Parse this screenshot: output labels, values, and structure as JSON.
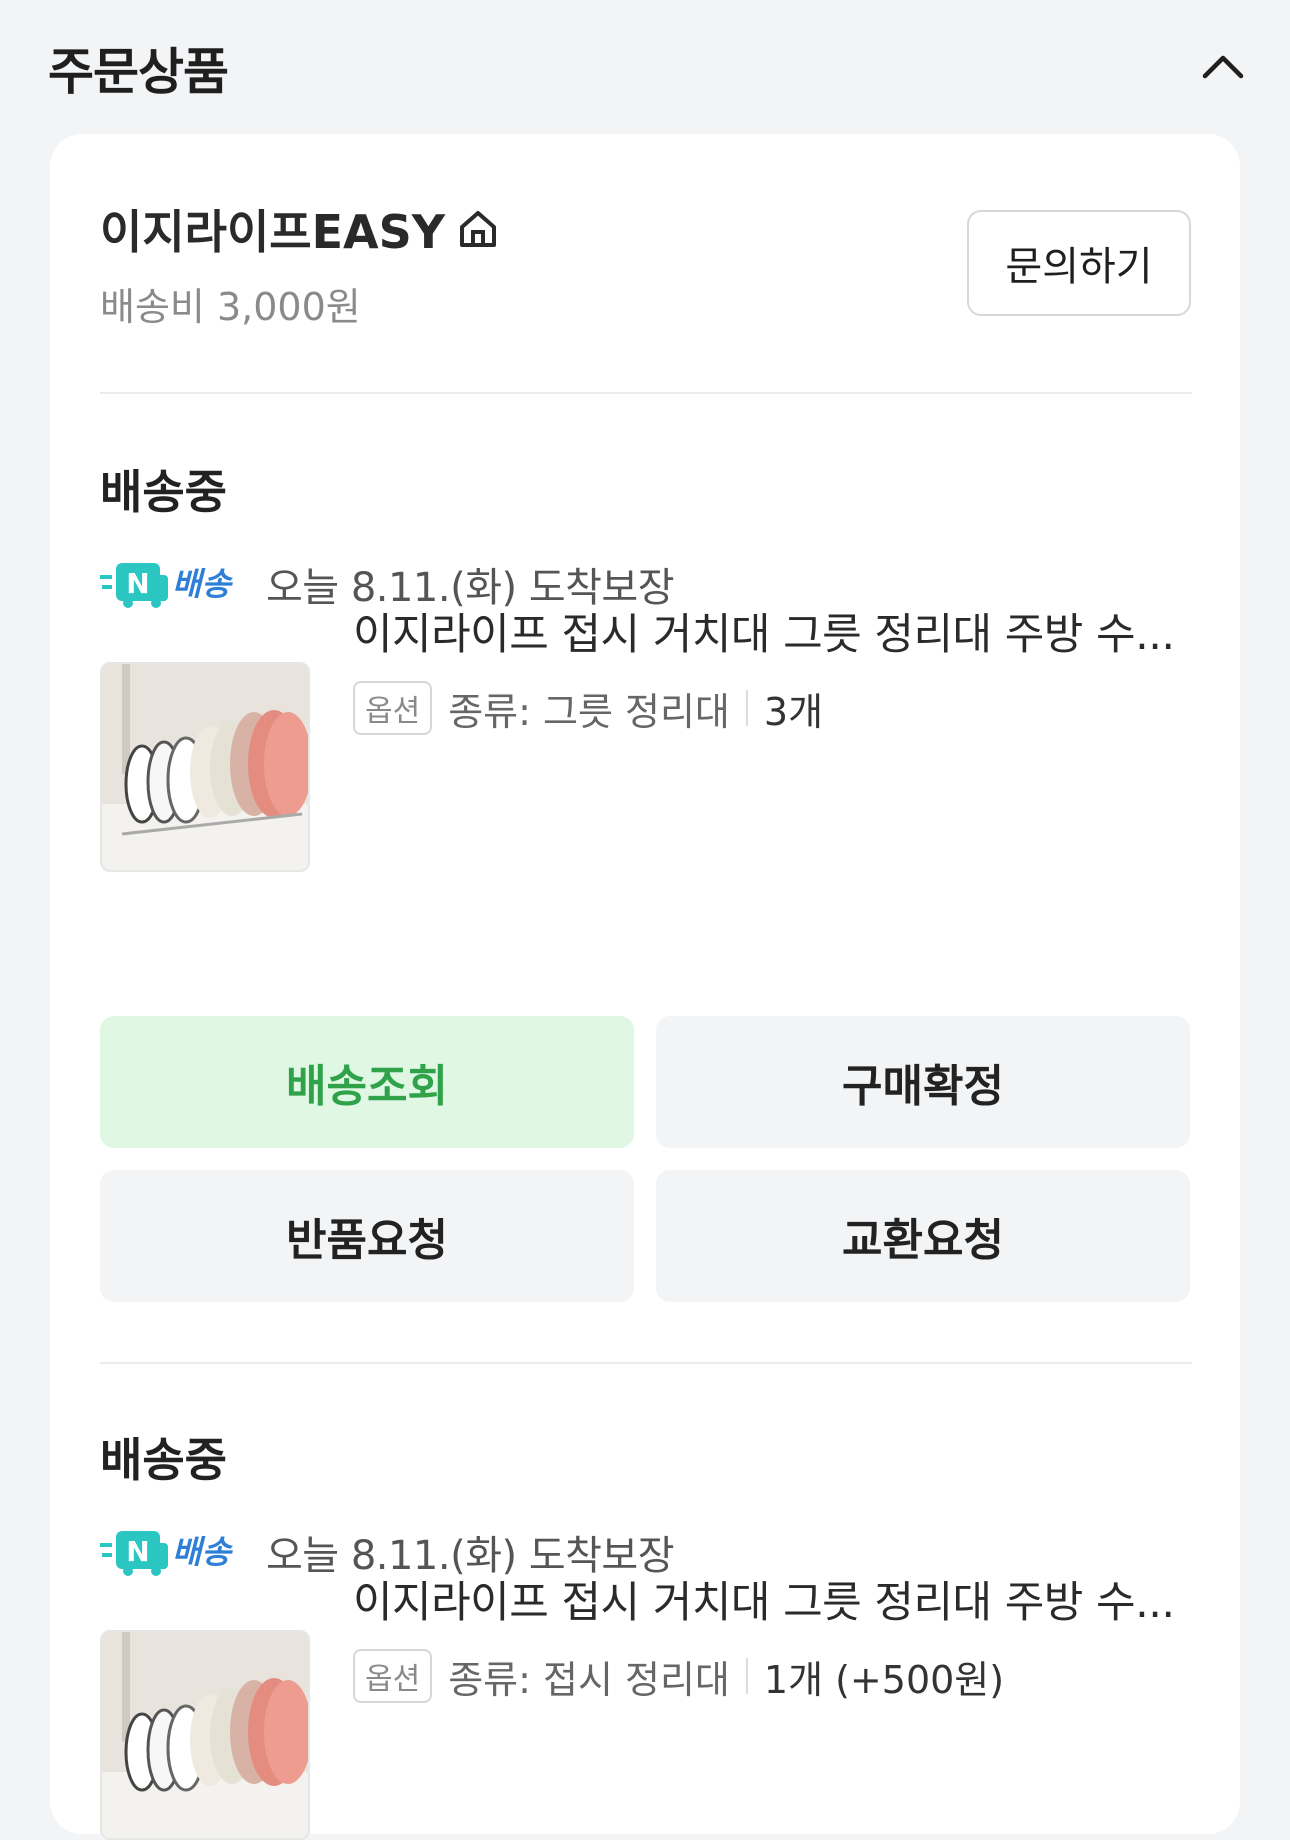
{
  "section": {
    "title": "주문상품"
  },
  "seller": {
    "name": "이지라이프EASY",
    "shipping_fee": "배송비 3,000원",
    "inquiry_label": "문의하기"
  },
  "orders": [
    {
      "status": "배송중",
      "delivery_badge": "배송",
      "delivery_text": "오늘 8.11.(화) 도착보장",
      "product_name": "이지라이프 접시 거치대 그릇 정리대 주방 수...",
      "option_tag": "옵션",
      "option_text": "종류: 그릇 정리대",
      "quantity": "3개",
      "actions": [
        "배송조회",
        "구매확정",
        "반품요청",
        "교환요청"
      ]
    },
    {
      "status": "배송중",
      "delivery_badge": "배송",
      "delivery_text": "오늘 8.11.(화) 도착보장",
      "product_name": "이지라이프 접시 거치대 그릇 정리대 주방 수...",
      "option_tag": "옵션",
      "option_text": "종류: 접시 정리대",
      "quantity": "1개 (+500원)"
    }
  ],
  "icons": {
    "collapse": "chevron-up-icon",
    "store": "home-icon",
    "delivery": "n-delivery-truck-icon"
  },
  "colors": {
    "accent_green": "#2fa24a",
    "accent_green_bg": "#dff7e3",
    "n_badge_teal": "#2bc5c2",
    "n_badge_text": "#2f7fd6"
  }
}
